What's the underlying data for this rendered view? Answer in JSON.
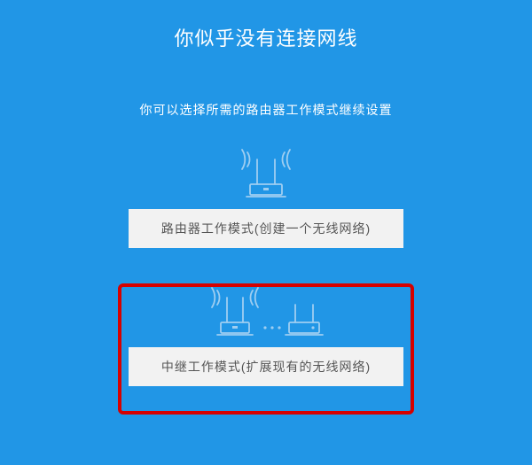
{
  "title": "你似乎没有连接网线",
  "subtitle": "你可以选择所需的路由器工作模式继续设置",
  "options": {
    "router_mode": "路由器工作模式(创建一个无线网络)",
    "relay_mode": "中继工作模式(扩展现有的无线网络)"
  },
  "colors": {
    "bg": "#2196e6",
    "button_bg": "#f2f2f2",
    "highlight": "#d60000",
    "icon": "#9fcef1"
  }
}
